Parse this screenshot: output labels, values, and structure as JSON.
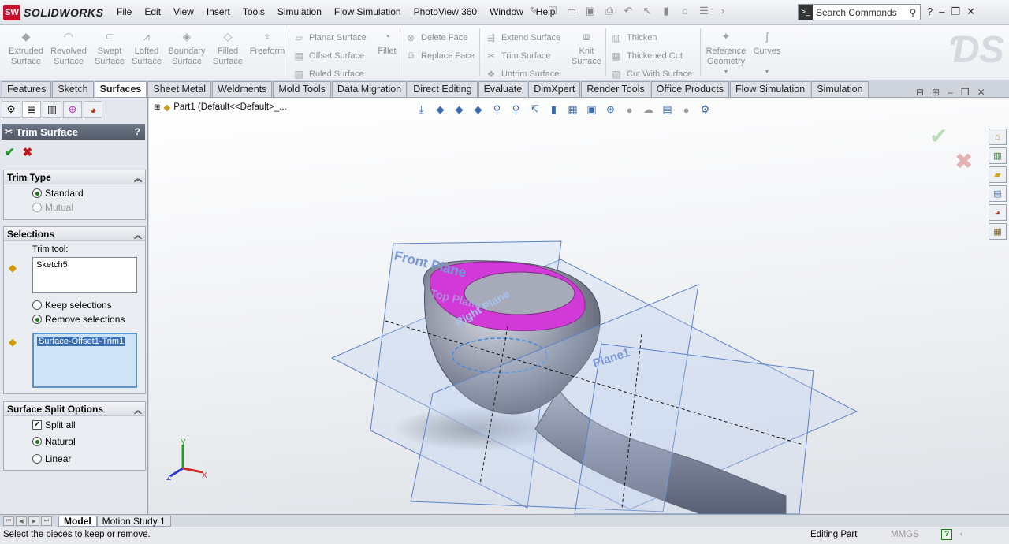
{
  "app": {
    "name": "SOLIDWORKS",
    "logo_mark": "SW"
  },
  "menu": [
    "File",
    "Edit",
    "View",
    "Insert",
    "Tools",
    "Simulation",
    "Flow Simulation",
    "PhotoView 360",
    "Window",
    "Help"
  ],
  "search": {
    "placeholder": "Search Commands"
  },
  "ribbon": {
    "big": [
      {
        "label": "Extruded Surface"
      },
      {
        "label": "Revolved Surface"
      },
      {
        "label": "Swept Surface"
      },
      {
        "label": "Lofted Surface"
      },
      {
        "label": "Boundary Surface"
      },
      {
        "label": "Filled Surface"
      },
      {
        "label": "Freeform"
      }
    ],
    "col1": [
      "Planar Surface",
      "Offset Surface",
      "Ruled Surface"
    ],
    "fillet": "Fillet",
    "col2": [
      "Delete Face",
      "Replace Face"
    ],
    "col3": [
      "Extend Surface",
      "Trim Surface",
      "Untrim Surface"
    ],
    "knit": "Knit Surface",
    "col4": [
      "Thicken",
      "Thickened Cut",
      "Cut With Surface"
    ],
    "refgeom": "Reference Geometry",
    "curves": "Curves"
  },
  "tabs": [
    "Features",
    "Sketch",
    "Surfaces",
    "Sheet Metal",
    "Weldments",
    "Mold Tools",
    "Data Migration",
    "Direct Editing",
    "Evaluate",
    "DimXpert",
    "Render Tools",
    "Office Products",
    "Flow Simulation",
    "Simulation"
  ],
  "active_tab": "Surfaces",
  "pm": {
    "title": "Trim Surface",
    "help": "?",
    "trim_type": {
      "header": "Trim Type",
      "options": [
        {
          "label": "Standard",
          "selected": true,
          "enabled": true
        },
        {
          "label": "Mutual",
          "selected": false,
          "enabled": false
        }
      ]
    },
    "selections": {
      "header": "Selections",
      "trim_tool_label": "Trim tool:",
      "trim_tool_value": "Sketch5",
      "options": [
        {
          "label": "Keep selections",
          "selected": false
        },
        {
          "label": "Remove selections",
          "selected": true
        }
      ],
      "pieces": [
        "Surface-Offset1-Trim1"
      ]
    },
    "split": {
      "header": "Surface Split Options",
      "split_all": {
        "label": "Split all",
        "checked": true
      },
      "options": [
        {
          "label": "Natural",
          "selected": true
        },
        {
          "label": "Linear",
          "selected": false
        }
      ]
    }
  },
  "viewport": {
    "feature_path": "Part1  (Default<<Default>_...",
    "planes": {
      "front": "Front Plane",
      "top": "Top Plane",
      "right": "Right Plane",
      "plane1": "Plane1"
    },
    "triad": {
      "x": "X",
      "y": "Y",
      "z": "Z"
    }
  },
  "bottom_tabs": [
    "Model",
    "Motion Study 1"
  ],
  "status": {
    "message": "Select the pieces to keep or remove.",
    "mode": "Editing Part",
    "units": "MMGS",
    "help": "?"
  },
  "colors": {
    "accent": "#c8102e",
    "plane": "#5b82c9",
    "magenta": "#d23ad7"
  }
}
